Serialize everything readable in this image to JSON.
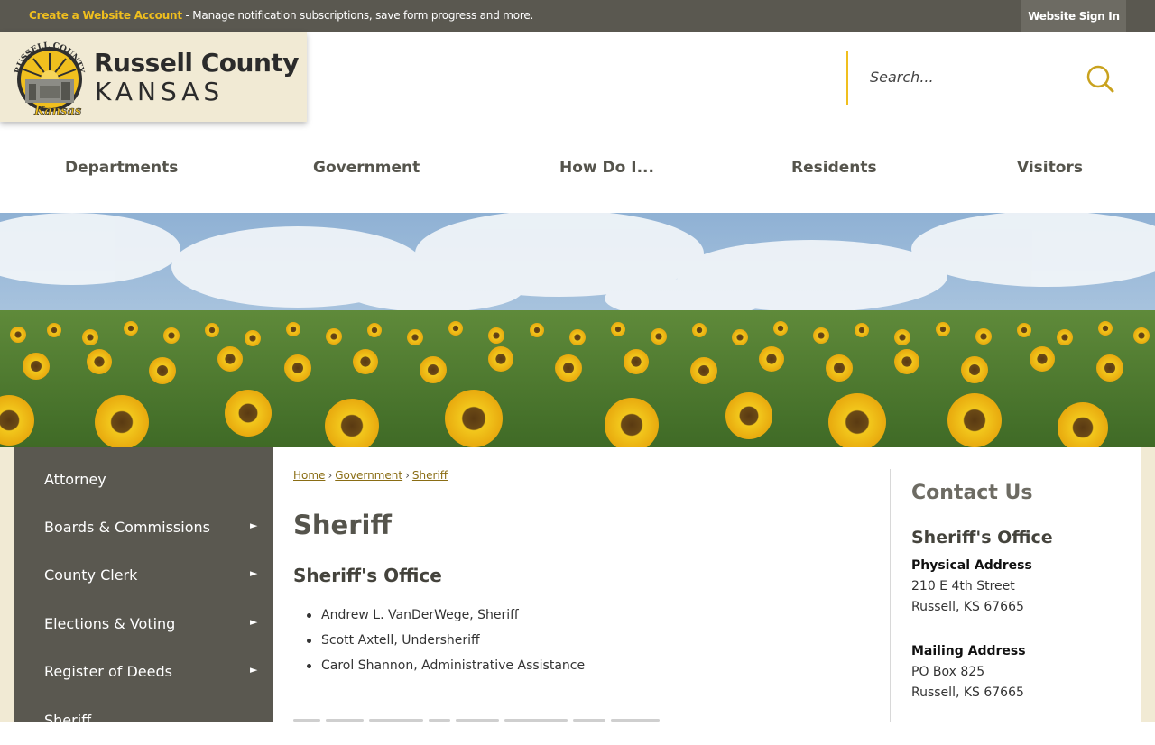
{
  "topbar": {
    "create_link": "Create a Website Account",
    "message": " - Manage notification subscriptions, save form progress and more.",
    "sign_in": "Website Sign In"
  },
  "logo": {
    "line1": "Russell County",
    "line2": "KANSAS",
    "seal_text": "RUSSELL COUNTY",
    "seal_script": "Kansas"
  },
  "search": {
    "placeholder": "Search..."
  },
  "nav": {
    "items": [
      {
        "label": "Departments"
      },
      {
        "label": "Government"
      },
      {
        "label": "How Do I..."
      },
      {
        "label": "Residents"
      },
      {
        "label": "Visitors"
      }
    ]
  },
  "sidebar": {
    "items": [
      {
        "label": "Attorney",
        "has_submenu": false
      },
      {
        "label": "Boards & Commissions",
        "has_submenu": true
      },
      {
        "label": "County Clerk",
        "has_submenu": true
      },
      {
        "label": "Elections & Voting",
        "has_submenu": true
      },
      {
        "label": "Register of Deeds",
        "has_submenu": true
      },
      {
        "label": "Sheriff",
        "has_submenu": false
      }
    ],
    "arrow": "►"
  },
  "breadcrumb": {
    "items": [
      "Home",
      "Government",
      "Sheriff"
    ],
    "separator": "›"
  },
  "main": {
    "title": "Sheriff",
    "section_title": "Sheriff's Office",
    "staff": [
      "Andrew L. VanDerWege, Sheriff",
      "Scott Axtell, Undersheriff",
      "Carol Shannon, Administrative Assistance"
    ]
  },
  "contact": {
    "title": "Contact Us",
    "office": "Sheriff's Office",
    "physical_label": "Physical Address",
    "physical_line1": "210 E 4th Street",
    "physical_line2": "Russell, KS 67665",
    "mailing_label": "Mailing Address",
    "mailing_line1": "PO Box 825",
    "mailing_line2": "Russell, KS 67665"
  },
  "colors": {
    "accent": "#f0bf1e",
    "dark": "#5a5850",
    "cream": "#f1ead4"
  }
}
